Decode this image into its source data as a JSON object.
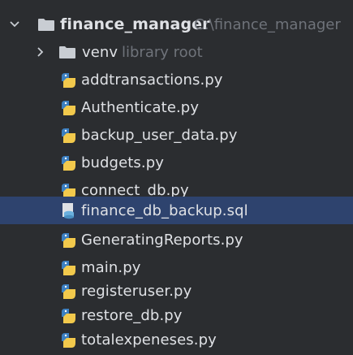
{
  "project": {
    "name": "finance_manager",
    "path": "C:\\finance_manager",
    "expanded": true,
    "icon": "folder-icon"
  },
  "venv": {
    "name": "venv",
    "hint": "library root",
    "expanded": false,
    "icon": "folder-icon"
  },
  "files": [
    {
      "name": "addtransactions.py",
      "icon": "python-file-icon"
    },
    {
      "name": "Authenticate.py",
      "icon": "python-file-icon"
    },
    {
      "name": "backup_user_data.py",
      "icon": "python-file-icon"
    },
    {
      "name": "budgets.py",
      "icon": "python-file-icon"
    },
    {
      "name": "connect_db.py",
      "icon": "python-file-icon"
    },
    {
      "name": "finance_db_backup.sql",
      "icon": "sql-file-icon"
    },
    {
      "name": "GeneratingReports.py",
      "icon": "python-file-icon"
    },
    {
      "name": "main.py",
      "icon": "python-file-icon"
    },
    {
      "name": "registeruser.py",
      "icon": "python-file-icon"
    },
    {
      "name": "restore_db.py",
      "icon": "python-file-icon"
    },
    {
      "name": "totalexpeneses.py",
      "icon": "python-file-icon"
    }
  ],
  "selected_file": "finance_db_backup.sql",
  "colors": {
    "background": "#2b2d30",
    "selection": "#2e436e",
    "text": "#dfe1e5",
    "hint": "#6f737a",
    "folder": "#c9cdd3",
    "python_blue": "#3c7fc0",
    "python_yellow": "#f2c94c",
    "sql_blue": "#6ab0de"
  }
}
